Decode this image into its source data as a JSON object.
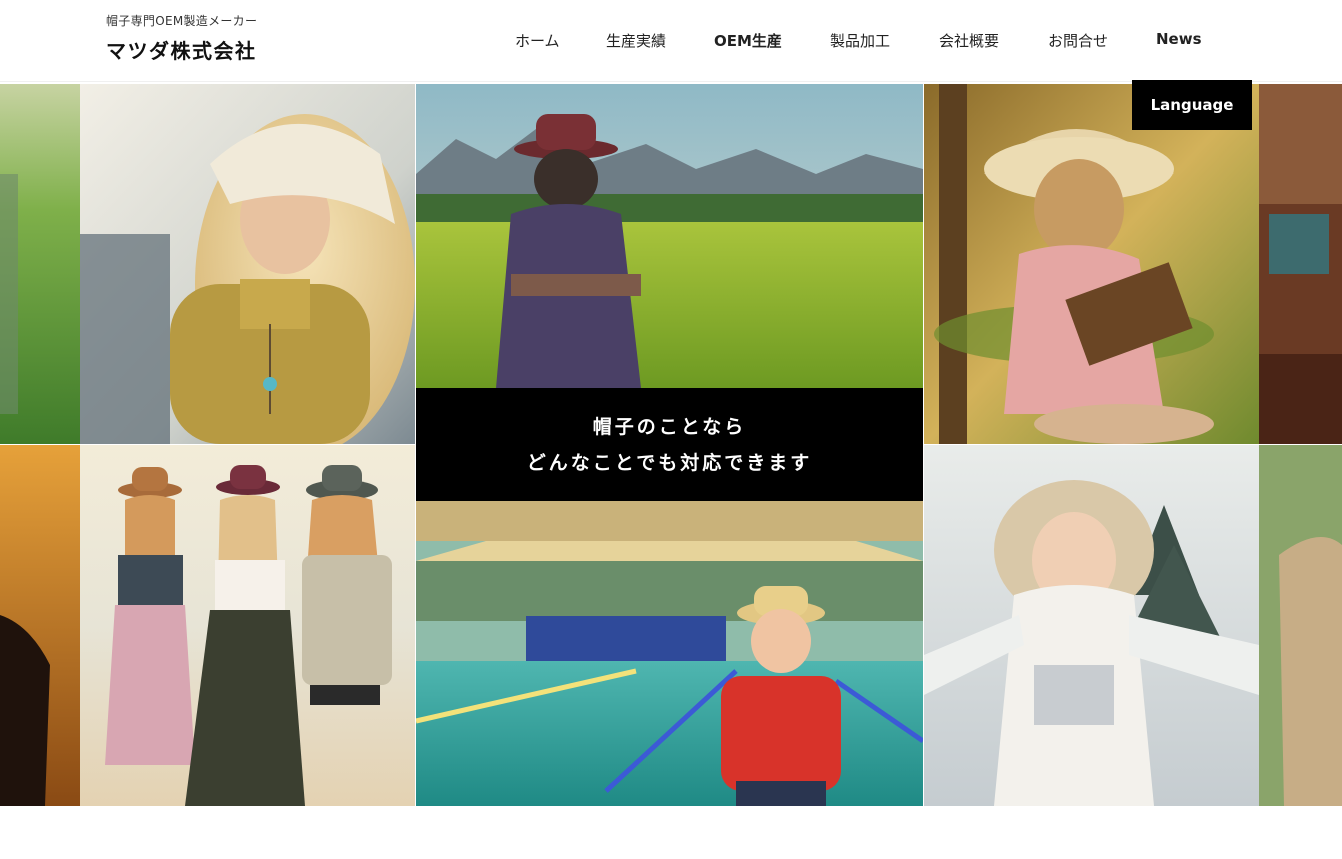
{
  "header": {
    "tagline": "帽子専門OEM製造メーカー",
    "company_name": "マツダ株式会社"
  },
  "nav": {
    "items": [
      {
        "label": "ホーム",
        "bold": false
      },
      {
        "label": "生産実績",
        "bold": false
      },
      {
        "label": "OEM生産",
        "bold": true
      },
      {
        "label": "製品加工",
        "bold": false
      },
      {
        "label": "会社概要",
        "bold": false
      },
      {
        "label": "お問合せ",
        "bold": false
      },
      {
        "label": "News",
        "bold": true
      }
    ]
  },
  "language_button": "Language",
  "hero": {
    "line1": "帽子のことなら",
    "line2": "どんなことでも対応できます"
  },
  "colors": {
    "accent": "#000000",
    "background": "#ffffff",
    "text": "#111111"
  }
}
